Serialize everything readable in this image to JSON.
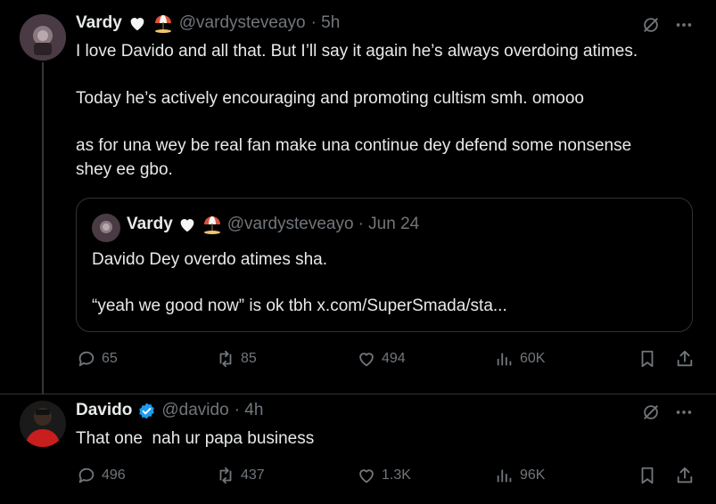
{
  "tweet1": {
    "name": "Vardy",
    "handle": "@vardysteveayo",
    "time": "· 5h",
    "lines": [
      "I love Davido and all that. But I’ll say it again he’s always overdoing atimes.",
      "Today he’s actively encouraging and promoting cultism smh. omooo",
      "as for una wey be real fan make una continue dey defend some nonsense",
      "shey ee gbo."
    ],
    "quote": {
      "name": "Vardy",
      "handle": "@vardysteveayo",
      "time": "· Jun 24",
      "line1": "Davido Dey overdo atimes sha.",
      "line2": "“yeah we good now” is ok tbh x.com/SuperSmada/sta..."
    },
    "stats": {
      "replies": "65",
      "reposts": "85",
      "likes": "494",
      "views": "60K"
    }
  },
  "tweet2": {
    "name": "Davido",
    "handle": "@davido",
    "time": "· 4h",
    "text": "That one  nah ur papa business",
    "stats": {
      "replies": "496",
      "reposts": "437",
      "likes": "1.3K",
      "views": "96K"
    }
  },
  "colors": {
    "background": "#000000",
    "text": "#e7e9ea",
    "muted": "#71767b",
    "verified": "#1d9bf0",
    "border": "#2f3336"
  },
  "icons": [
    "grok-icon",
    "more-icon",
    "reply-icon",
    "repost-icon",
    "like-icon",
    "views-icon",
    "bookmark-icon",
    "share-icon",
    "white-heart-icon",
    "beach-umbrella-icon",
    "verified-badge-icon"
  ]
}
